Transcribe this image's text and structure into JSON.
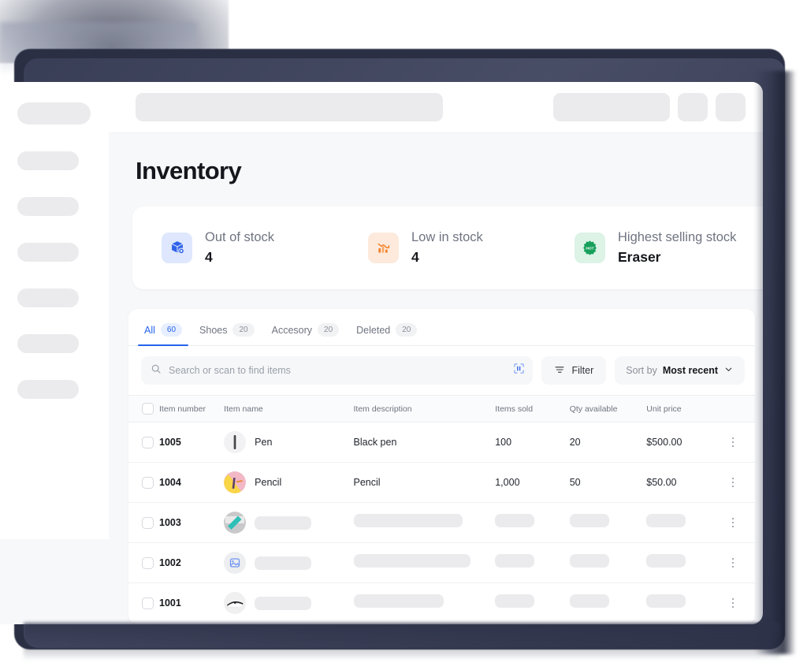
{
  "page": {
    "title": "Inventory"
  },
  "sidebar": {
    "logo_placeholder": "",
    "nav_placeholders": [
      "",
      "",
      "",
      "",
      "",
      ""
    ]
  },
  "topbar": {
    "search_placeholder_skeleton": "",
    "action_skeleton": "",
    "icon_skeleton_1": "",
    "icon_skeleton_2": ""
  },
  "stats": [
    {
      "icon": "package-box-icon",
      "label": "Out of stock",
      "value": "4",
      "accent": "#2f62e8",
      "bg": "#dee7fd"
    },
    {
      "icon": "chart-decline-icon",
      "label": "Low in stock",
      "value": "4",
      "accent": "#f2802a",
      "bg": "#fdeadc"
    },
    {
      "icon": "hot-badge-icon",
      "label": "Highest selling stock",
      "value": "Eraser",
      "accent": "#17a05b",
      "bg": "#dcf3e6"
    }
  ],
  "tabs": [
    {
      "label": "All",
      "count": "60",
      "active": true
    },
    {
      "label": "Shoes",
      "count": "20",
      "active": false
    },
    {
      "label": "Accesory",
      "count": "20",
      "active": false
    },
    {
      "label": "Deleted",
      "count": "20",
      "active": false
    }
  ],
  "toolbar": {
    "search_value": "",
    "search_placeholder": "Search or scan to find items",
    "scan_icon": "barcode-scan-icon",
    "filter_label": "Filter",
    "filter_icon": "filter-icon",
    "sort_prefix": "Sort by",
    "sort_value": "Most recent",
    "sort_chevron": "chevron-down-icon"
  },
  "table": {
    "columns": [
      "Item number",
      "Item name",
      "Item description",
      "Items sold",
      "Qty available",
      "Unit price"
    ],
    "rows": [
      {
        "number": "1005",
        "name": "Pen",
        "description": "Black pen",
        "sold": "100",
        "qty": "20",
        "price": "$500.00",
        "thumb": "pen-thumbnail",
        "loading": false
      },
      {
        "number": "1004",
        "name": "Pencil",
        "description": "Pencil",
        "sold": "1,000",
        "qty": "50",
        "price": "$50.00",
        "thumb": "pencil-thumbnail",
        "loading": false
      },
      {
        "number": "1003",
        "name": "",
        "description": "",
        "sold": "",
        "qty": "",
        "price": "",
        "thumb": "teal-object-thumbnail",
        "loading": true
      },
      {
        "number": "1002",
        "name": "",
        "description": "",
        "sold": "",
        "qty": "",
        "price": "",
        "thumb": "image-placeholder-thumbnail",
        "loading": true
      },
      {
        "number": "1001",
        "name": "",
        "description": "",
        "sold": "",
        "qty": "",
        "price": "",
        "thumb": "glasses-thumbnail",
        "loading": true
      }
    ]
  },
  "colors": {
    "accent_blue": "#2563eb",
    "text_dark": "#15171c",
    "text_muted": "#6f7480",
    "skeleton": "#ebebed",
    "canvas": "#f7f8fa"
  }
}
